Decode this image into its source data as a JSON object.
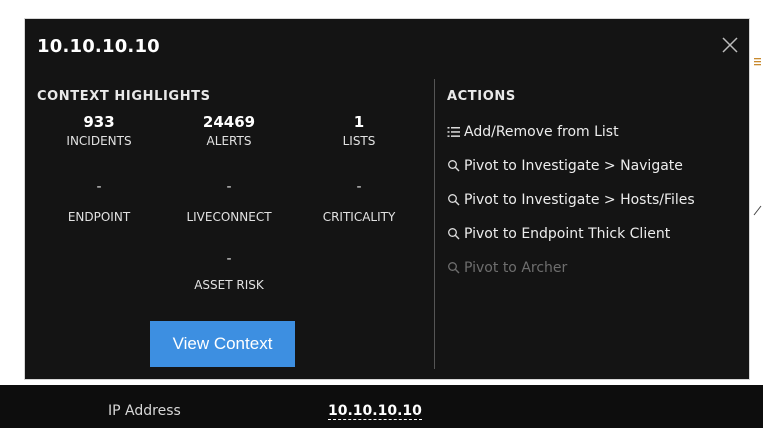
{
  "popup": {
    "title": "10.10.10.10",
    "close_icon": "close-icon"
  },
  "context_highlights": {
    "heading": "CONTEXT HIGHLIGHTS",
    "stats": [
      {
        "value": "933",
        "label": "INCIDENTS"
      },
      {
        "value": "24469",
        "label": "ALERTS"
      },
      {
        "value": "1",
        "label": "LISTS"
      },
      {
        "value": "-",
        "label": "ENDPOINT"
      },
      {
        "value": "-",
        "label": "LIVECONNECT"
      },
      {
        "value": "-",
        "label": "CRITICALITY"
      },
      {
        "value": "-",
        "label": "ASSET RISK"
      }
    ],
    "view_context_label": "View Context"
  },
  "actions": {
    "heading": "ACTIONS",
    "items": [
      {
        "label": "Add/Remove from List",
        "icon": "list-icon",
        "enabled": true
      },
      {
        "label": "Pivot to Investigate > Navigate",
        "icon": "search-icon",
        "enabled": true
      },
      {
        "label": "Pivot to Investigate > Hosts/Files",
        "icon": "search-icon",
        "enabled": true
      },
      {
        "label": "Pivot to Endpoint Thick Client",
        "icon": "search-icon",
        "enabled": true
      },
      {
        "label": "Pivot to Archer",
        "icon": "search-icon",
        "enabled": false
      }
    ]
  },
  "field": {
    "label": "IP Address",
    "value": "10.10.10.10"
  },
  "colors": {
    "popup_bg": "#141414",
    "accent_button": "#3d8fe1",
    "border": "#d6d6d6",
    "disabled_text": "#6e6e6e"
  }
}
